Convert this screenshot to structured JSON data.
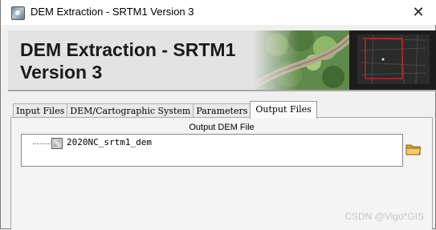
{
  "window": {
    "title": "DEM Extraction - SRTM1 Version 3",
    "close_label": "✕"
  },
  "banner": {
    "title": "DEM Extraction - SRTM1 Version 3"
  },
  "tabs": [
    {
      "label": "Input Files",
      "active": false
    },
    {
      "label": "DEM/Cartographic System",
      "active": false
    },
    {
      "label": "Parameters",
      "active": false
    },
    {
      "label": "Output Files",
      "active": true
    }
  ],
  "output": {
    "section_label": "Output DEM File",
    "file_name": "2020NC_srtm1_dem",
    "browse_icon": "folder-icon"
  },
  "watermark": "CSDN @Vigo*GIS",
  "colors": {
    "banner_bg": "#e3e3e3",
    "selection_box": "#e02020",
    "folder": "#e8b84a"
  }
}
